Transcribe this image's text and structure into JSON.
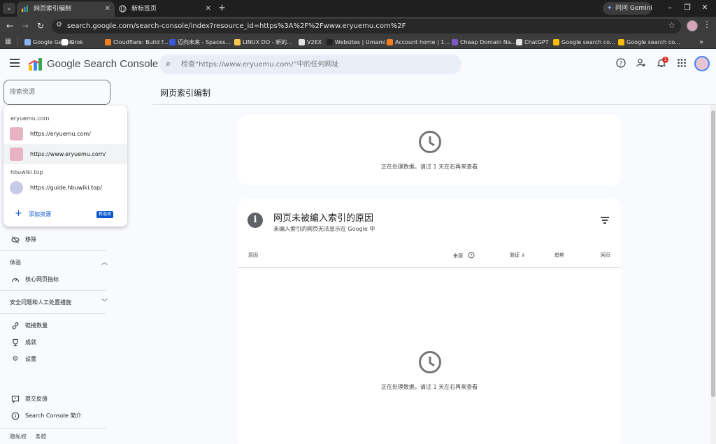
{
  "browser": {
    "tabs": [
      {
        "title": "网页索引编制",
        "active": true
      },
      {
        "title": "新标签页",
        "active": false
      }
    ],
    "gemini_button": "问问 Gemini",
    "url": "search.google.com/search-console/index?resource_id=https%3A%2F%2Fwww.eryuemu.com%2F",
    "bookmarks": [
      {
        "label": "Google Gemini",
        "color": "#8ab4f8"
      },
      {
        "label": "Grok",
        "color": "#ffffff"
      },
      {
        "label": "Cloudflare: Build f...",
        "color": "#f38020"
      },
      {
        "label": "迈向未来 - Spaces...",
        "color": "#3b5bdb"
      },
      {
        "label": "LINUX DO - 新的...",
        "color": "#f9c74f"
      },
      {
        "label": "V2EX",
        "color": "#e3e3e3"
      },
      {
        "label": "Websites | Umami",
        "color": "#222222"
      },
      {
        "label": "Account home | 1...",
        "color": "#f38020"
      },
      {
        "label": "Cheap Domain Na...",
        "color": "#7e57c2"
      },
      {
        "label": "ChatGPT",
        "color": "#e3e3e3"
      },
      {
        "label": "Google search co...",
        "color": "#fbbc04"
      },
      {
        "label": "Google search co...",
        "color": "#fbbc04"
      }
    ]
  },
  "header": {
    "product_name": "Google Search Console",
    "search_placeholder": "检查“https://www.eryuemu.com/”中的任何网址",
    "notification_count": "1"
  },
  "sidebar": {
    "resource_search_placeholder": "搜索资源",
    "dropdown": {
      "groups": [
        {
          "name": "eryuemu.com",
          "items": [
            "https://eryuemu.com/",
            "https://www.eryuemu.com/"
          ]
        },
        {
          "name": "hbuwiki.top",
          "items": [
            "https://guide.hbuwiki.top/"
          ]
        }
      ],
      "add_label": "添加资源",
      "new_badge": "新选项"
    },
    "removals": "移除",
    "experience_section": "体验",
    "core_web_vitals": "核心网页指标",
    "security_section": "安全问题和人工处置措施",
    "links": "链接数量",
    "achievements": "成就",
    "settings": "设置",
    "feedback": "提交反馈",
    "about": "Search Console 简介",
    "footer": {
      "privacy": "隐私权",
      "terms": "条款"
    }
  },
  "main": {
    "page_title": "网页索引编制",
    "card1_status": "正在处理数据，请过 1 天左右再来查看",
    "card2": {
      "title": "网页未被编入索引的原因",
      "subtitle": "未编入索引的网页无法显示在 Google 中",
      "columns": {
        "reason": "原因",
        "source": "来源",
        "validation": "验证",
        "trend": "趋势",
        "pages": "网页"
      },
      "status": "正在处理数据，请过 1 天左右再来查看"
    }
  }
}
